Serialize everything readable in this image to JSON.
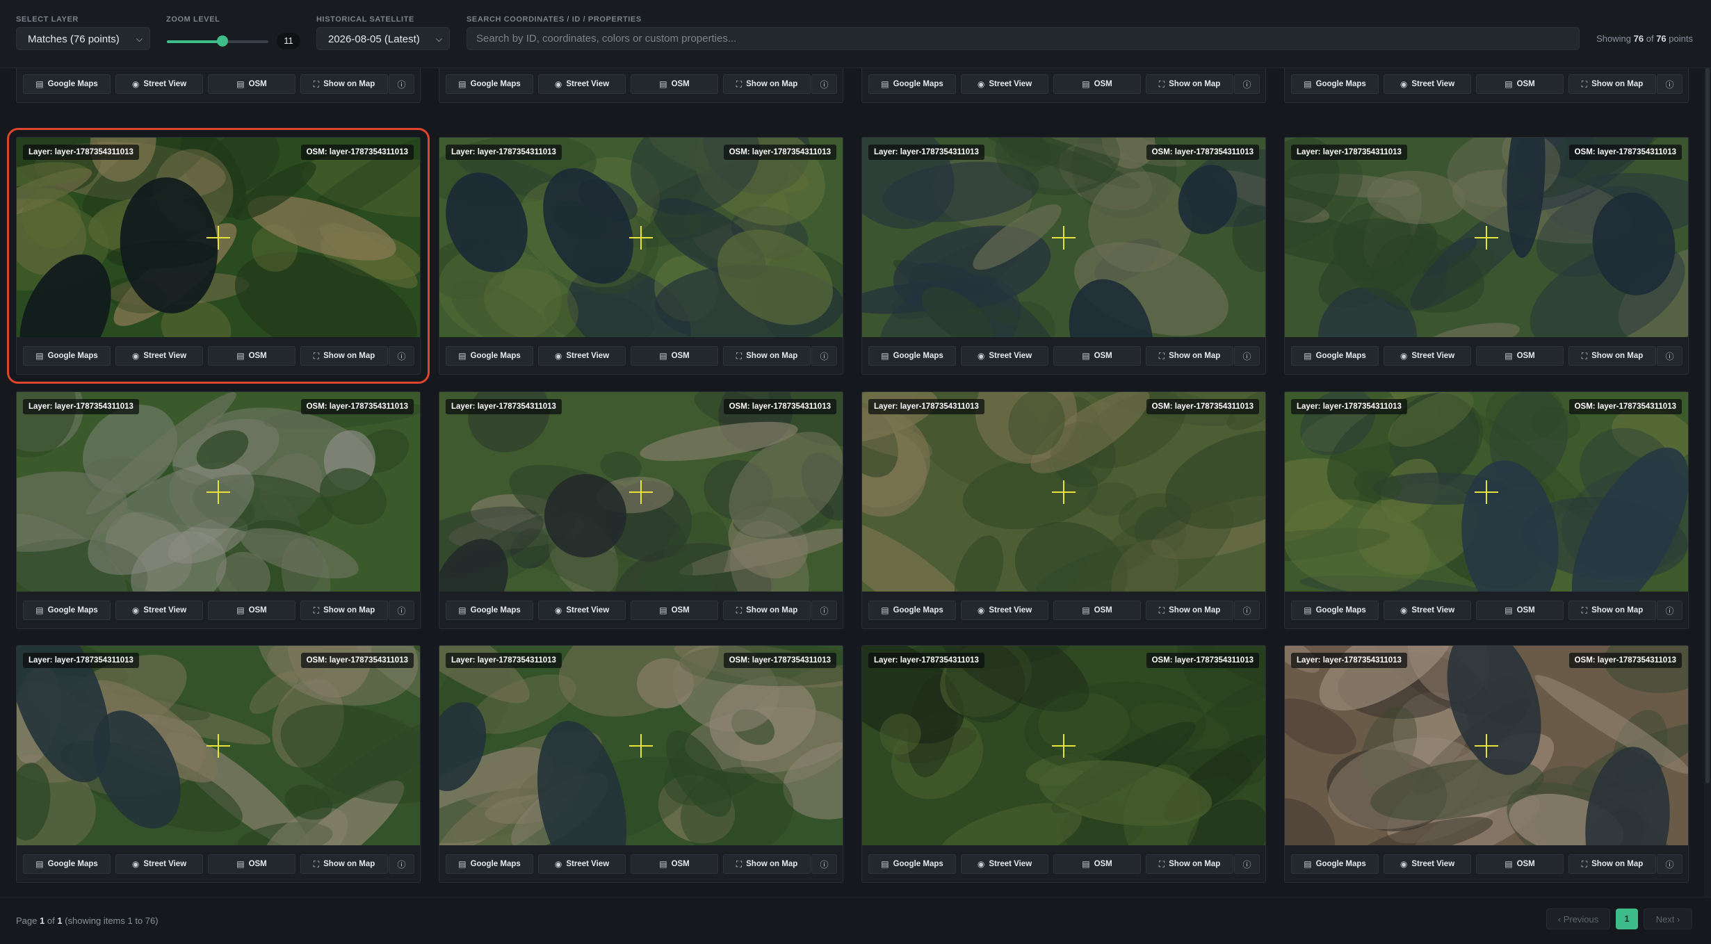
{
  "toolbar": {
    "layer_label": "SELECT LAYER",
    "layer_value": "Matches (76 points)",
    "zoom_label": "ZOOM LEVEL",
    "zoom_value": "11",
    "zoom_fraction": 0.55,
    "satellite_label": "HISTORICAL SATELLITE",
    "satellite_value": "2026-08-05 (Latest)",
    "search_label": "SEARCH COORDINATES / ID / PROPERTIES",
    "search_placeholder": "Search by ID, coordinates, colors or custom properties...",
    "showing_prefix": "Showing",
    "showing_count": "76",
    "showing_of": "of",
    "showing_total": "76",
    "showing_suffix": "points"
  },
  "card_common": {
    "layer_tag": "Layer: layer-1787354311013",
    "osm_tag": "OSM: layer-1787354311013",
    "buttons": {
      "google_maps": "Google Maps",
      "street_view": "Street View",
      "osm": "OSM",
      "show_on_map": "Show on Map"
    },
    "icons": {
      "google_maps": "map-icon",
      "street_view": "eye-icon",
      "osm": "map-icon",
      "show_on_map": "expand-icon",
      "info": "info-icon"
    }
  },
  "cards": [
    {
      "row": 0,
      "col": 0,
      "terrain": "forest"
    },
    {
      "row": 0,
      "col": 1,
      "terrain": "coastal"
    },
    {
      "row": 0,
      "col": 2,
      "terrain": "fjord"
    },
    {
      "row": 0,
      "col": 3,
      "terrain": "fjord"
    },
    {
      "row": 1,
      "col": 0,
      "terrain": "forest-lakes",
      "selected": true
    },
    {
      "row": 1,
      "col": 1,
      "terrain": "fjord-ridges"
    },
    {
      "row": 1,
      "col": 2,
      "terrain": "fjord-town"
    },
    {
      "row": 1,
      "col": 3,
      "terrain": "fjord-town"
    },
    {
      "row": 2,
      "col": 0,
      "terrain": "town-fields"
    },
    {
      "row": 2,
      "col": 1,
      "terrain": "mountain-lakes"
    },
    {
      "row": 2,
      "col": 2,
      "terrain": "farmland"
    },
    {
      "row": 2,
      "col": 3,
      "terrain": "hills"
    },
    {
      "row": 3,
      "col": 0,
      "terrain": "river-mountain"
    },
    {
      "row": 3,
      "col": 1,
      "terrain": "river-mountain"
    },
    {
      "row": 3,
      "col": 2,
      "terrain": "forest"
    },
    {
      "row": 3,
      "col": 3,
      "terrain": "ridges"
    }
  ],
  "footer": {
    "page_prefix": "Page",
    "page_current": "1",
    "page_of": "of",
    "page_total": "1",
    "page_suffix": "(showing items 1 to 76)",
    "previous_label": "Previous",
    "current_page_label": "1",
    "next_label": "Next"
  },
  "colors": {
    "accent": "#3ebd8b",
    "selection": "#e0442f",
    "crosshair": "#e8e23a"
  }
}
